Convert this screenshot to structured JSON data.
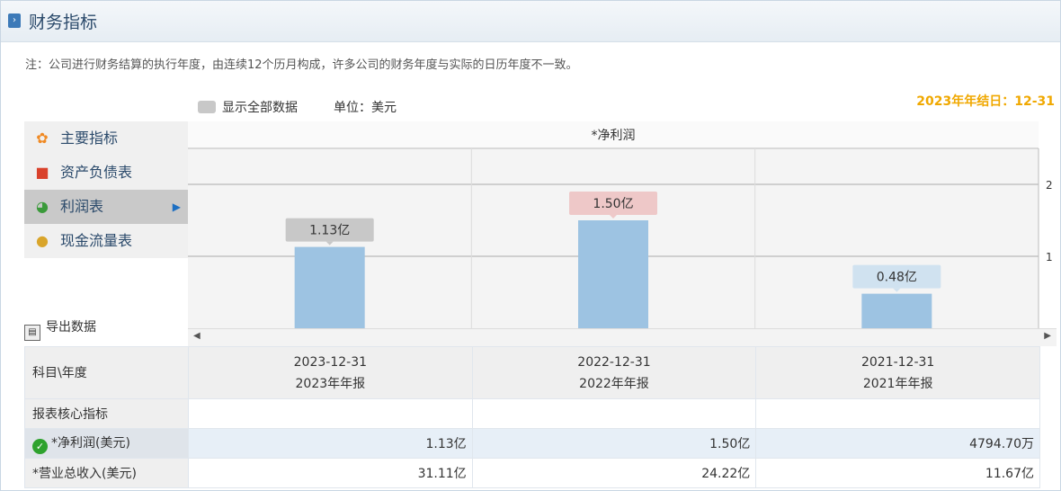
{
  "header": {
    "title": "财务指标"
  },
  "note": "注：公司进行财务结算的执行年度，由连续12个历月构成，许多公司的财务年度与实际的日历年度不一致。",
  "toolbar": {
    "show_all": "显示全部数据",
    "unit": "单位：美元"
  },
  "year_end": "2023年年结日：12-31",
  "sidebar": {
    "items": [
      {
        "label": "主要指标",
        "icon": "gear-icon"
      },
      {
        "label": "资产负债表",
        "icon": "document-icon"
      },
      {
        "label": "利润表",
        "icon": "pie-icon"
      },
      {
        "label": "现金流量表",
        "icon": "coins-icon"
      }
    ],
    "export": "导出数据"
  },
  "chart_data": {
    "type": "bar",
    "title": "*净利润",
    "categories": [
      "2023-12-31",
      "2022-12-31",
      "2021-12-31"
    ],
    "values": [
      1.13,
      1.5,
      0.48
    ],
    "labels": [
      "1.13亿",
      "1.50亿",
      "0.48亿"
    ],
    "yticks": [
      "1",
      "2"
    ],
    "ylim": [
      0,
      2.5
    ],
    "colors": {
      "bar": "#9dc3e2",
      "label_bg": [
        "#c8c8c8",
        "#eec8c8",
        "#d0e2f0"
      ]
    }
  },
  "table": {
    "corner": "科目\\年度",
    "columns": [
      {
        "date": "2023-12-31",
        "report": "2023年年报"
      },
      {
        "date": "2022-12-31",
        "report": "2022年年报"
      },
      {
        "date": "2021-12-31",
        "report": "2021年年报"
      }
    ],
    "section": "报表核心指标",
    "rows": [
      {
        "label": "*净利润(美元)",
        "values": [
          "1.13亿",
          "1.50亿",
          "4794.70万"
        ]
      },
      {
        "label": "*营业总收入(美元)",
        "values": [
          "31.11亿",
          "24.22亿",
          "11.67亿"
        ]
      }
    ]
  }
}
